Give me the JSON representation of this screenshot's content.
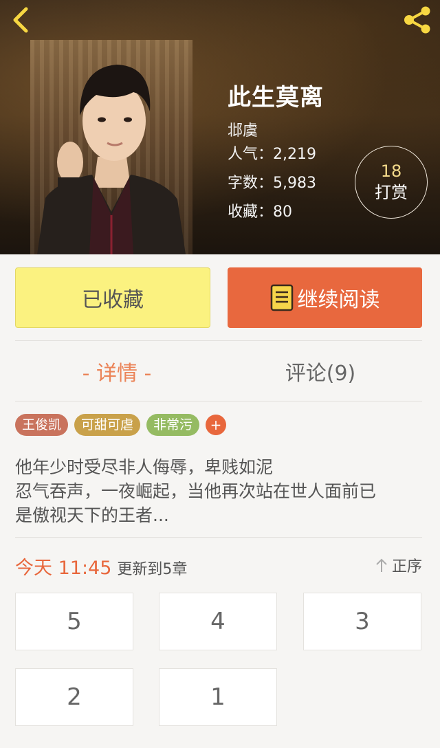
{
  "header": {
    "back_icon": "chevron-left-icon",
    "share_icon": "share-icon",
    "icon_color": "#f7d742"
  },
  "book": {
    "title": "此生莫离",
    "author": "邶虞",
    "popularity_label": "人气：",
    "popularity": "2,219",
    "words_label": "字数：",
    "words": "5,983",
    "favorites_label": "收藏：",
    "favorites": "80"
  },
  "reward": {
    "count": "18",
    "label": "打赏"
  },
  "actions": {
    "favorited_label": "已收藏",
    "continue_label": "继续阅读",
    "continue_icon": "book-icon"
  },
  "tabs": [
    {
      "label": "- 详情 -",
      "active": true
    },
    {
      "label": "评论(9)",
      "active": false
    }
  ],
  "tags": [
    {
      "label": "王俊凯",
      "color": "#c9735d"
    },
    {
      "label": "可甜可虐",
      "color": "#c9a14a"
    },
    {
      "label": "非常污",
      "color": "#95bb62"
    }
  ],
  "add_tag_label": "+",
  "description": {
    "line1": "他年少时受尽非人侮辱，卑贱如泥",
    "line2": "忍气吞声，一夜崛起，当他再次站在世人面前已",
    "line3": "是傲视天下的王者..."
  },
  "update": {
    "time": "今天 11:45",
    "text": "更新到5章",
    "sort_label": "正序",
    "sort_icon": "arrow-up-icon"
  },
  "chapters": [
    "5",
    "4",
    "3",
    "2",
    "1"
  ],
  "colors": {
    "accent": "#e8673c",
    "favorite_bg": "#fbf280",
    "active_tab": "#eb8458"
  }
}
